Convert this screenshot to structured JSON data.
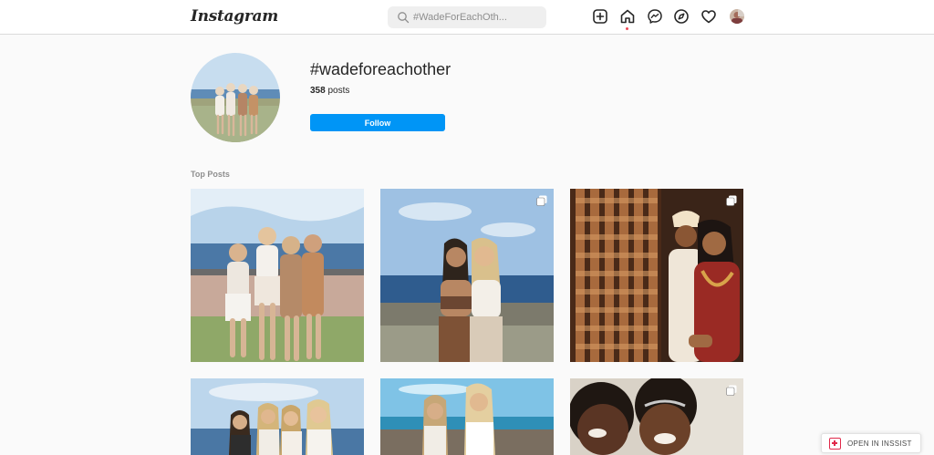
{
  "app": {
    "logo_text": "Instagram"
  },
  "search": {
    "placeholder": "#WadeForEachOth..."
  },
  "nav": {
    "icons": [
      "new-post-icon",
      "home-icon",
      "messenger-icon",
      "explore-icon",
      "activity-heart-icon",
      "profile-avatar"
    ],
    "active": "home-icon"
  },
  "hashtag": {
    "title": "#wadeforeachother",
    "post_count": "358",
    "posts_suffix": "posts",
    "follow_label": "Follow"
  },
  "top_posts": {
    "label": "Top Posts",
    "items": [
      {
        "scene": "four women in white and tan outfits posing by the sea",
        "multiple": false
      },
      {
        "scene": "two women posing by the ocean",
        "multiple": true
      },
      {
        "scene": "couple in traditional wedding attire",
        "multiple": true
      },
      {
        "scene": "group of women by the sea",
        "multiple": false
      },
      {
        "scene": "two women laughing by the water",
        "multiple": false
      },
      {
        "scene": "two smiling girls selfie indoors",
        "multiple": true
      }
    ]
  },
  "extension": {
    "label": "OPEN IN INSSIST"
  },
  "colors": {
    "accent": "#0095f6",
    "notification": "#ed4956",
    "inssist": "#e0294a"
  }
}
